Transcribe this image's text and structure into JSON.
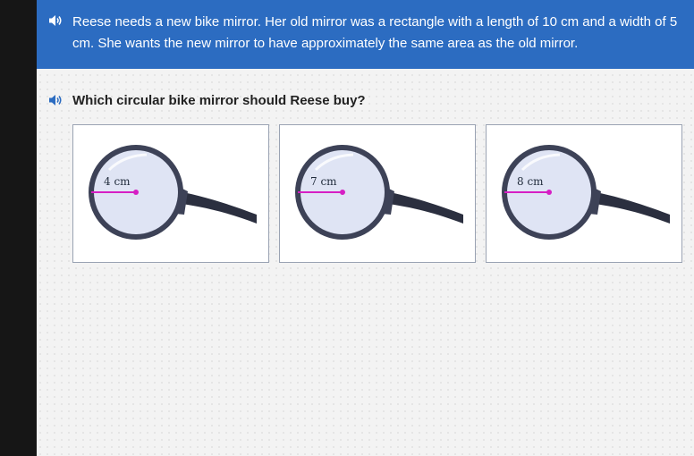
{
  "prompt": {
    "text": "Reese needs a new bike mirror. Her old mirror was a rectangle with a length of 10 cm and a width of 5 cm. She wants the new mirror to have approximately the same area as the old mirror.",
    "speaker_icon": "speaker-icon"
  },
  "question": {
    "text": "Which circular bike mirror should Reese buy?",
    "speaker_icon": "speaker-icon"
  },
  "options": [
    {
      "radius_label": "4 cm"
    },
    {
      "radius_label": "7 cm"
    },
    {
      "radius_label": "8 cm"
    }
  ],
  "colors": {
    "prompt_bar": "#2c6cc1",
    "radius_line": "#d61fc4",
    "mirror_glass": "#dfe4f4",
    "mirror_rim": "#3d4257",
    "handle": "#2b2f3f"
  }
}
